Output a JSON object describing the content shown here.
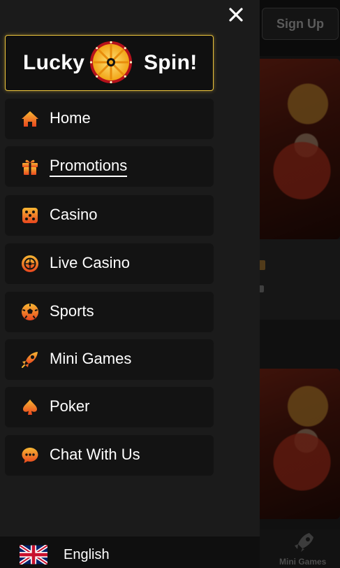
{
  "background": {
    "signup_label": "Sign Up",
    "bottom_nav_label": "Mini Games"
  },
  "drawer": {
    "close_icon": "close-icon",
    "lucky_spin": {
      "word1": "Lucky",
      "word2": "Spin!",
      "icon": "spin-wheel-icon",
      "accent": "#e9c23c"
    },
    "menu": [
      {
        "label": "Home",
        "icon": "home-icon"
      },
      {
        "label": "Promotions",
        "icon": "gift-icon"
      },
      {
        "label": "Casino",
        "icon": "dice-icon"
      },
      {
        "label": "Live Casino",
        "icon": "roulette-icon"
      },
      {
        "label": "Sports",
        "icon": "ball-icon"
      },
      {
        "label": "Mini Games",
        "icon": "rocket-icon"
      },
      {
        "label": "Poker",
        "icon": "spade-icon"
      },
      {
        "label": "Chat With Us",
        "icon": "chat-icon"
      }
    ],
    "language": {
      "label": "English",
      "icon": "uk-flag-icon"
    }
  },
  "colors": {
    "drawer_bg": "#1b1b1b",
    "item_bg": "#131313",
    "icon_gradient_start": "#f7b733",
    "icon_gradient_end": "#e8461e"
  }
}
